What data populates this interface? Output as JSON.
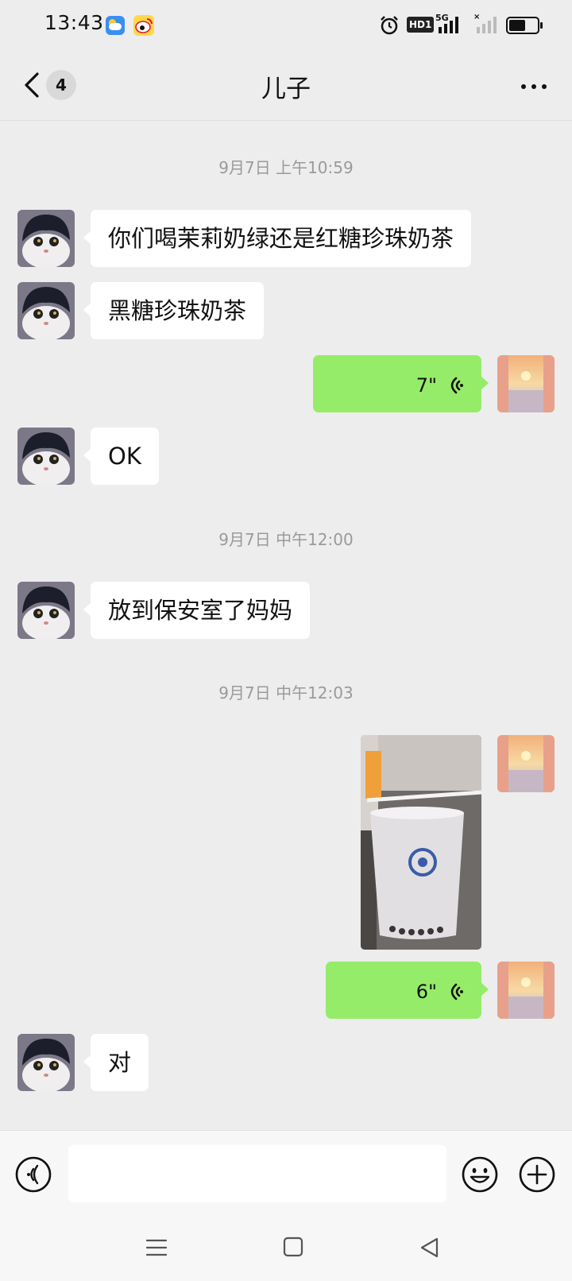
{
  "status_bar": {
    "time": "13:43",
    "apps": [
      "weather-icon",
      "weibo-icon"
    ],
    "right_icons": [
      "alarm-icon",
      "hd-icon",
      "5g-signal-icon",
      "signal-icon",
      "battery-icon"
    ],
    "hd_label": "HD1",
    "network_label": "5G",
    "battery_level": 0.6
  },
  "header": {
    "back_badge": "4",
    "title": "儿子",
    "more_icon": "more-icon"
  },
  "messages": [
    {
      "type": "timestamp",
      "text": "9月7日 上午10:59"
    },
    {
      "type": "text",
      "side": "left",
      "text": "你们喝茉莉奶绿还是红糖珍珠奶茶"
    },
    {
      "type": "text",
      "side": "left",
      "text": "黑糖珍珠奶茶"
    },
    {
      "type": "voice",
      "side": "right",
      "duration": "7\""
    },
    {
      "type": "text",
      "side": "left",
      "text": "OK"
    },
    {
      "type": "timestamp",
      "text": "9月7日 中午12:00"
    },
    {
      "type": "text",
      "side": "left",
      "text": "放到保安室了妈妈"
    },
    {
      "type": "timestamp",
      "text": "9月7日 中午12:03"
    },
    {
      "type": "image",
      "side": "right",
      "description_icon": "milk-tea-photo"
    },
    {
      "type": "voice",
      "side": "right",
      "duration": "6\""
    },
    {
      "type": "text",
      "side": "left",
      "text": "对"
    }
  ],
  "input_bar": {
    "placeholder": "",
    "icons": [
      "voice-mode-icon",
      "emoji-icon",
      "plus-icon"
    ]
  },
  "system_nav": [
    "menu-icon",
    "home-icon",
    "back-icon"
  ],
  "colors": {
    "background": "#ededed",
    "bubble_out": "#95ec69",
    "bubble_in": "#ffffff",
    "timestamp": "#9a9a9a"
  }
}
